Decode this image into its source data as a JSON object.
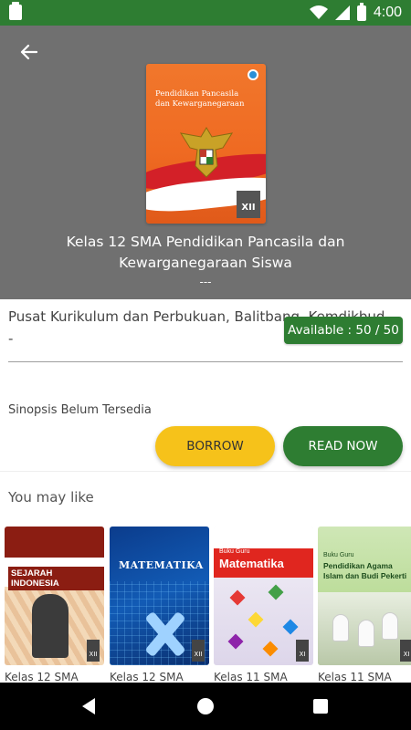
{
  "status_bar": {
    "time": "4:00"
  },
  "book": {
    "cover_title_line1": "Pendidikan Pancasila",
    "cover_title_line2": "dan Kewarganegaraan",
    "cover_grade": "XII",
    "title": "Kelas 12 SMA Pendidikan Pancasila dan Kewarganegaraan Siswa",
    "subtitle": "---",
    "author": "Pusat Kurikulum dan Perbukuan, Balitbang, Kemdikbud",
    "author_tail": "-",
    "availability": "Available : 50 / 50",
    "synopsis": "Sinopsis Belum Tersedia"
  },
  "actions": {
    "borrow_label": "BORROW",
    "read_label": "READ NOW"
  },
  "recommendations": {
    "heading": "You may like",
    "items": [
      {
        "cover_title": "SEJARAH INDONESIA",
        "grade": "XII",
        "label": "Kelas 12 SMA"
      },
      {
        "cover_title": "MATEMATIKA",
        "grade": "XII",
        "label": "Kelas 12 SMA"
      },
      {
        "cover_kicker": "Buku Guru",
        "cover_title": "Matematika",
        "grade": "XI",
        "label": "Kelas 11 SMA"
      },
      {
        "cover_kicker": "Buku Guru",
        "cover_title": "Pendidikan Agama Islam dan Budi Pekerti",
        "grade": "XI",
        "label": "Kelas 11 SMA"
      }
    ]
  },
  "colors": {
    "primary": "#2e7d32",
    "accent": "#f6c21a",
    "header": "#707070"
  }
}
